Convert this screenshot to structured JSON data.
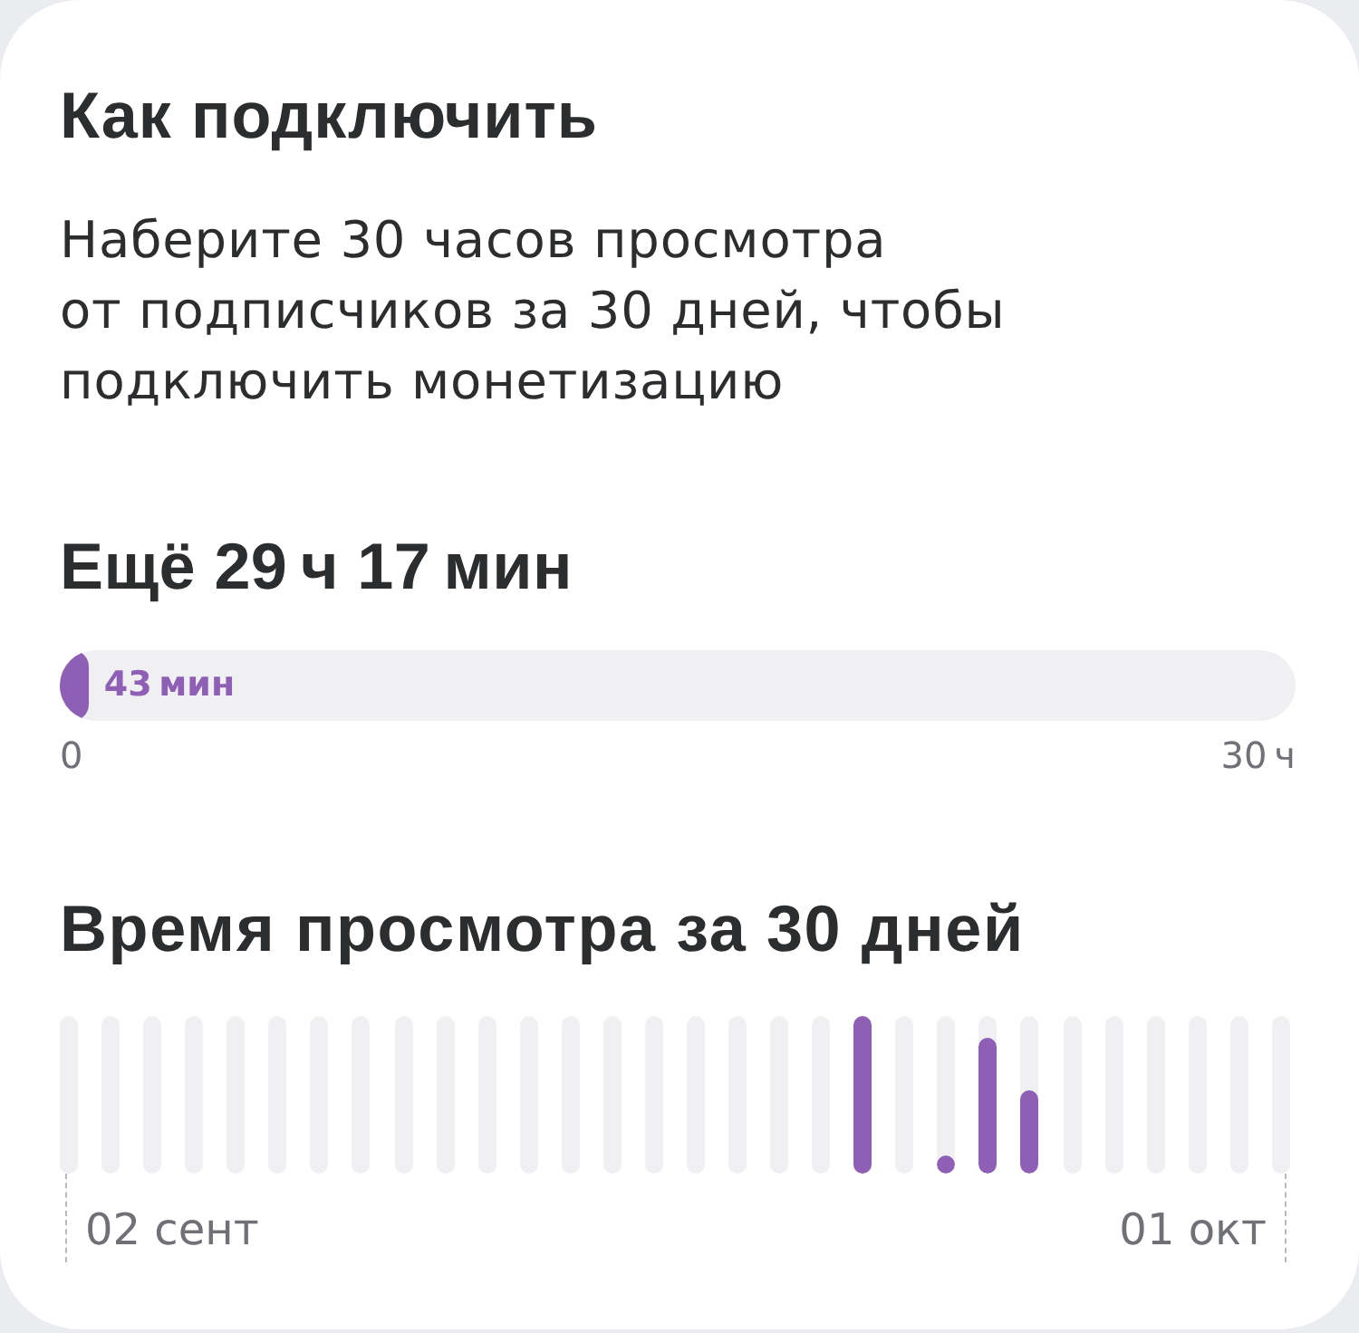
{
  "intro": {
    "title": "Как подключить",
    "text": "Наберите 30 часов просмотра\nот подписчиков за 30 дней, чтобы\nподключить монетизацию"
  },
  "progress": {
    "remaining": "Ещё 29 ч 17 мин",
    "level": 0.024,
    "value_label": "43 мин",
    "scale_start": "0",
    "scale_end": "30 ч"
  },
  "chart": {
    "title": "Время просмотра за 30 дней",
    "axis_start_label": "02 сент",
    "axis_end_label": "01 окт"
  }
}
